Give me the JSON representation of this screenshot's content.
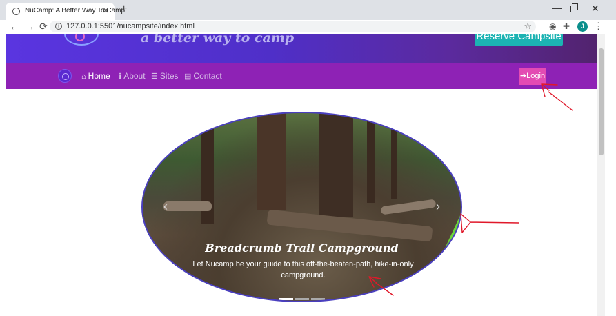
{
  "browser": {
    "tab_title": "NuCamp: A Better Way To Camp",
    "tab_close": "✕",
    "new_tab": "+",
    "url": "127.0.0.1:5501/nucampsite/index.html",
    "profile_initial": "J",
    "window_controls": {
      "minimize": "—",
      "close": "✕"
    },
    "nav": {
      "back": "←",
      "forward": "→",
      "reload": "⟳"
    },
    "bookmark_star": "☆",
    "menu": "⋮"
  },
  "jumbotron": {
    "tagline": "a better way to camp",
    "reserve_button": "Reserve Campsite"
  },
  "navbar": {
    "items": [
      {
        "label": "Home",
        "icon": "home-icon",
        "glyph": "⌂"
      },
      {
        "label": "About",
        "icon": "info-icon",
        "glyph": "ℹ"
      },
      {
        "label": "Sites",
        "icon": "list-icon",
        "glyph": "☰"
      },
      {
        "label": "Contact",
        "icon": "address-card-icon",
        "glyph": "▤"
      }
    ],
    "login": {
      "label": "Login",
      "glyph": "➔"
    }
  },
  "carousel": {
    "caption_title": "Breadcrumb Trail Campground",
    "caption_text": "Let Nucamp be your guide to this off-the-beaten-path, hike-in-only campground.",
    "prev_glyph": "‹",
    "next_glyph": "›",
    "slide_count": 3,
    "active_slide": 1
  },
  "colors": {
    "navbar": "#8e22b5",
    "login": "#e34bb3",
    "reserve": "#1cb3b3",
    "annotation": "#e0182a"
  }
}
